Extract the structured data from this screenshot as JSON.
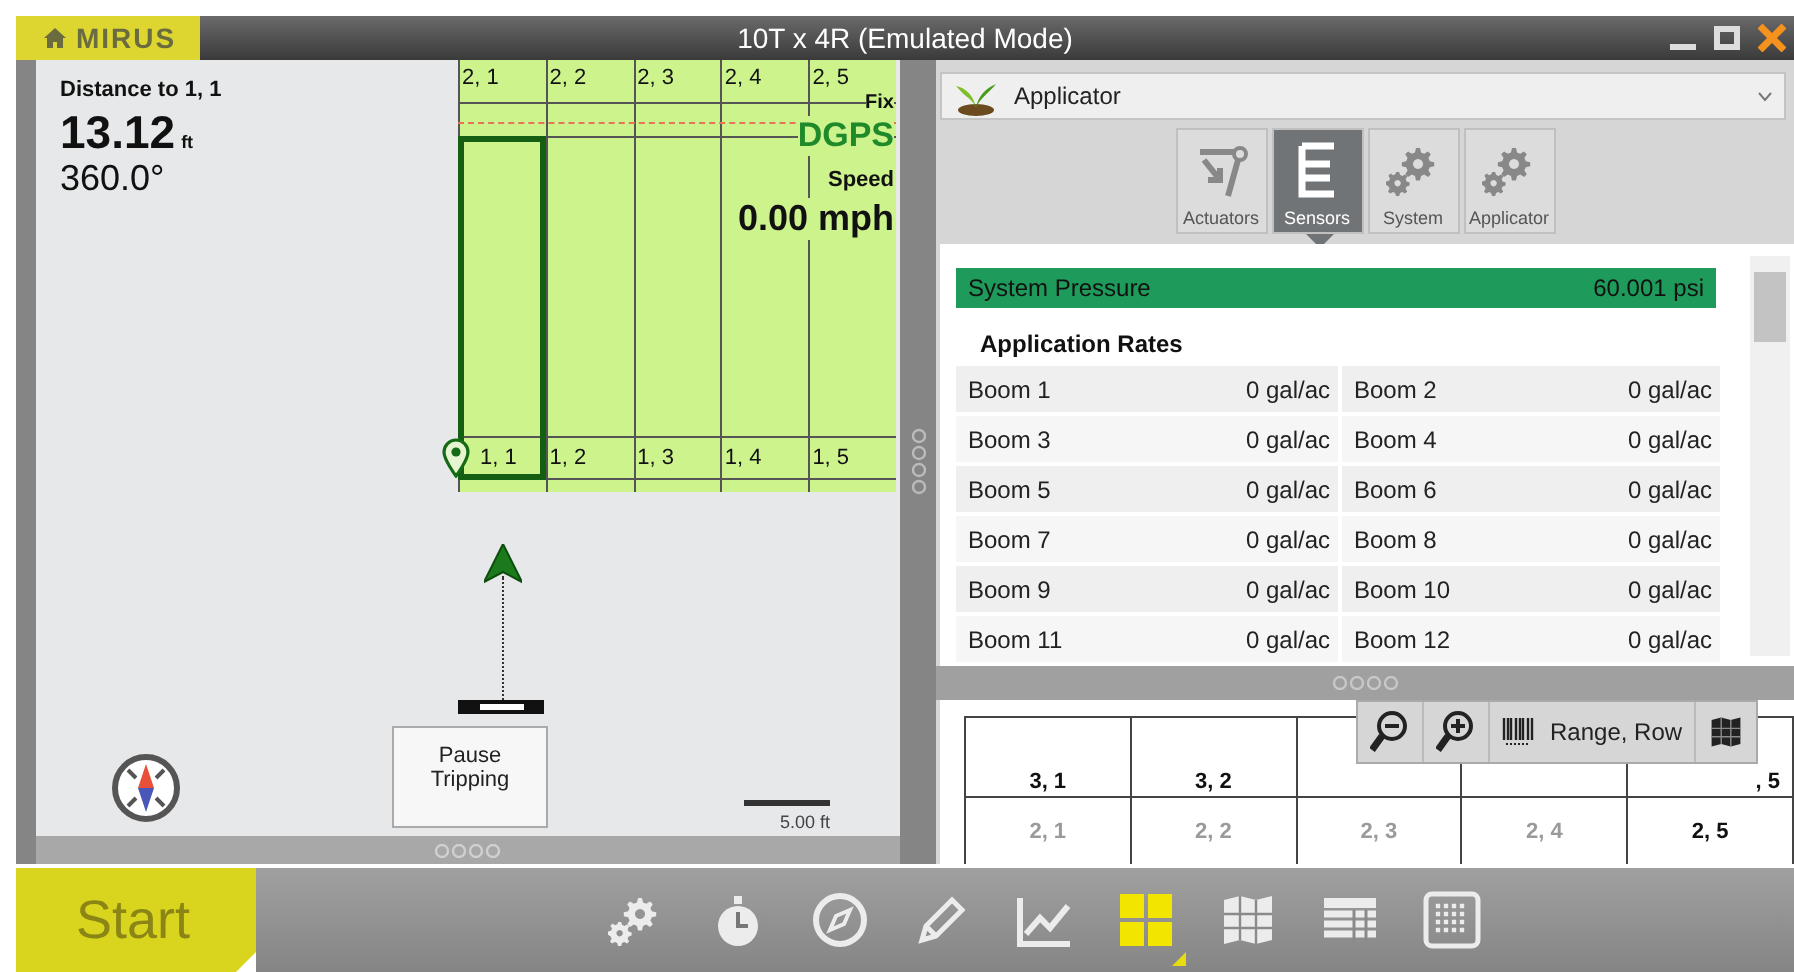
{
  "window": {
    "logo": "MIRUS",
    "title": "10T x 4R (Emulated Mode)"
  },
  "guidance": {
    "distance_label": "Distance to 1, 1",
    "distance_value": "13.12",
    "distance_unit": "ft",
    "heading": "360.0°",
    "fix_label": "Fix",
    "fix_value": "DGPS",
    "speed_label": "Speed",
    "speed_value": "0.00 mph",
    "pause_button": "Pause Tripping",
    "scale": "5.00 ft"
  },
  "map_grid": {
    "columns": [
      {
        "top": "2, 1",
        "bottom": "1, 1",
        "selected": true
      },
      {
        "top": "2, 2",
        "bottom": "1, 2",
        "selected": false
      },
      {
        "top": "2, 3",
        "bottom": "1, 3",
        "selected": false
      },
      {
        "top": "2, 4",
        "bottom": "1, 4",
        "selected": false
      },
      {
        "top": "2, 5",
        "bottom": "1, 5",
        "selected": false
      }
    ]
  },
  "device_select": {
    "value": "Applicator"
  },
  "tabs": [
    {
      "label": "Actuators",
      "kind": "actuators",
      "selected": false
    },
    {
      "label": "Sensors",
      "kind": "sensors",
      "selected": true
    },
    {
      "label": "System",
      "kind": "gears",
      "selected": false
    },
    {
      "label": "Applicator",
      "kind": "gears",
      "selected": false
    }
  ],
  "pressure": {
    "label": "System Pressure",
    "value": "60.001 psi"
  },
  "rates_heading": "Application Rates",
  "booms": [
    {
      "name": "Boom 1",
      "value": "0 gal/ac"
    },
    {
      "name": "Boom 2",
      "value": "0 gal/ac"
    },
    {
      "name": "Boom 3",
      "value": "0 gal/ac"
    },
    {
      "name": "Boom 4",
      "value": "0 gal/ac"
    },
    {
      "name": "Boom 5",
      "value": "0 gal/ac"
    },
    {
      "name": "Boom 6",
      "value": "0 gal/ac"
    },
    {
      "name": "Boom 7",
      "value": "0 gal/ac"
    },
    {
      "name": "Boom 8",
      "value": "0 gal/ac"
    },
    {
      "name": "Boom 9",
      "value": "0 gal/ac"
    },
    {
      "name": "Boom 10",
      "value": "0 gal/ac"
    },
    {
      "name": "Boom 11",
      "value": "0 gal/ac"
    },
    {
      "name": "Boom 12",
      "value": "0 gal/ac"
    }
  ],
  "layout_grid": {
    "rows": [
      [
        {
          "label": "3, 1",
          "dimmed": false
        },
        {
          "label": "3, 2",
          "dimmed": false
        },
        {},
        {},
        {
          "label": ", 5",
          "dimmed": false
        }
      ],
      [
        {
          "label": "2, 1",
          "dimmed": true
        },
        {
          "label": "2, 2",
          "dimmed": true
        },
        {
          "label": "2, 3",
          "dimmed": true
        },
        {
          "label": "2, 4",
          "dimmed": true
        },
        {
          "label": "2, 5",
          "dimmed": false
        }
      ]
    ],
    "range_button": "Range, Row"
  },
  "start_button": {
    "label": "Start",
    "disabled": true
  },
  "toolbar": [
    {
      "kind": "gears",
      "selected": false
    },
    {
      "kind": "stopwatch",
      "selected": false
    },
    {
      "kind": "compass",
      "selected": false
    },
    {
      "kind": "pencil",
      "selected": false
    },
    {
      "kind": "chart",
      "selected": false
    },
    {
      "kind": "tiles",
      "selected": true
    },
    {
      "kind": "map",
      "selected": false
    },
    {
      "kind": "table",
      "selected": false
    },
    {
      "kind": "keypad",
      "selected": false
    }
  ]
}
